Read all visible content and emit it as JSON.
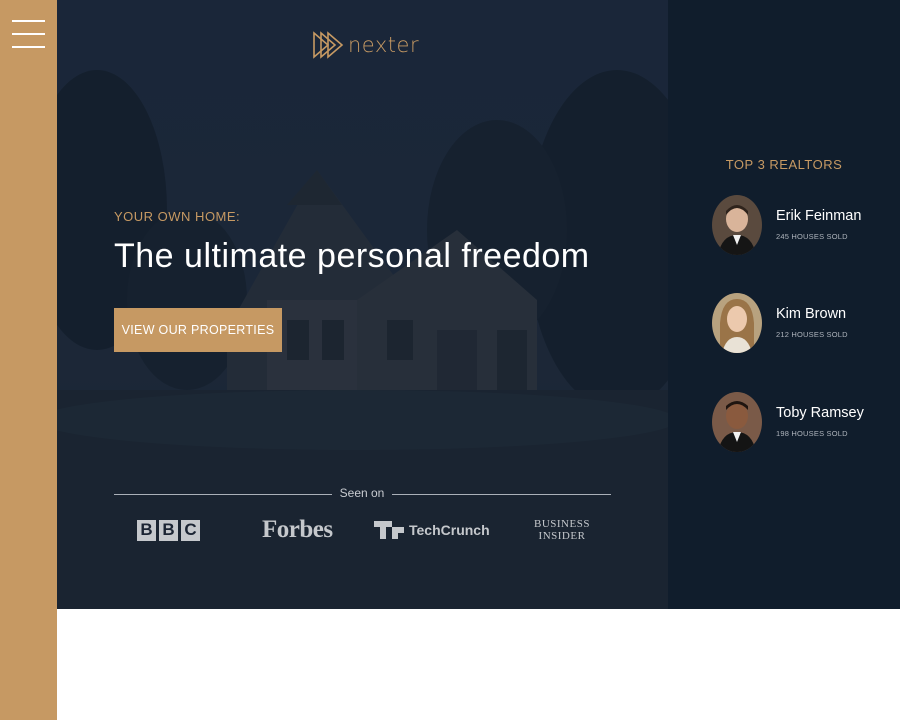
{
  "brand": {
    "name": "nexter"
  },
  "hero": {
    "pre_title": "YOUR OWN HOME:",
    "headline": "The ultimate personal freedom",
    "cta_label": "VIEW OUR PROPERTIES",
    "seen_on_label": "Seen on"
  },
  "press": {
    "bbc": [
      "B",
      "B",
      "C"
    ],
    "forbes": "Forbes",
    "techcrunch": "TechCrunch",
    "business_insider": [
      "BUSINESS",
      "INSIDER"
    ]
  },
  "realtors": {
    "title": "TOP 3 REALTORS",
    "items": [
      {
        "name": "Erik Feinman",
        "sold": "245 HOUSES SOLD"
      },
      {
        "name": "Kim Brown",
        "sold": "212 HOUSES SOLD"
      },
      {
        "name": "Toby Ramsey",
        "sold": "198 HOUSES SOLD"
      }
    ]
  },
  "colors": {
    "primary": "#c69963",
    "dark_panel": "#101d2c",
    "white": "#ffffff"
  },
  "icons": [
    "menu-icon",
    "nexter-logo-icon"
  ]
}
